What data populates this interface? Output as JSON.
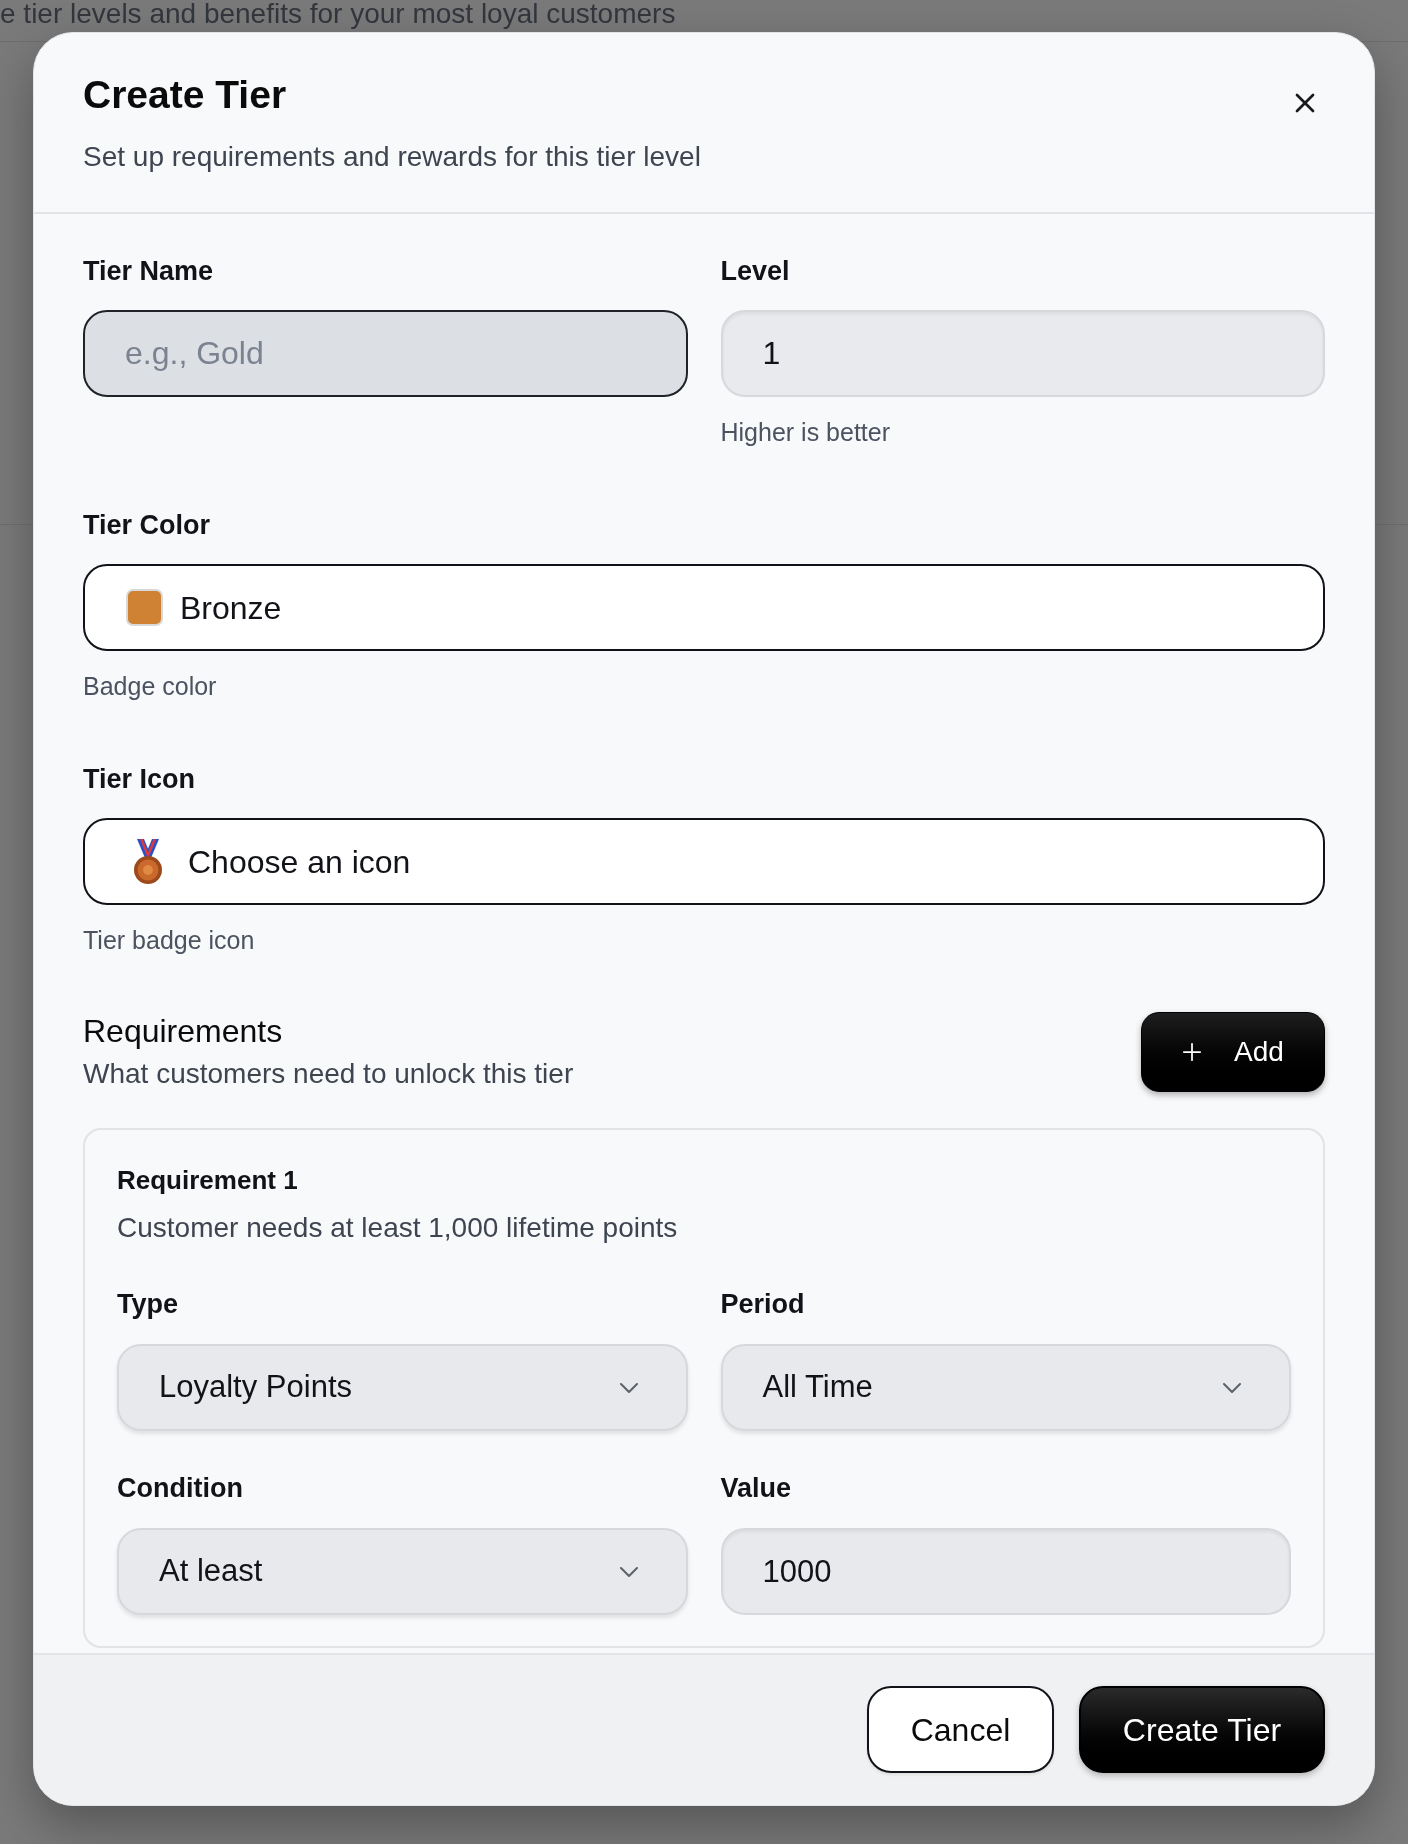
{
  "background": {
    "text": "e tier levels and benefits for your most loyal customers"
  },
  "dialog": {
    "title": "Create Tier",
    "subtitle": "Set up requirements and rewards for this tier level"
  },
  "tier_name": {
    "label": "Tier Name",
    "placeholder": "e.g., Gold",
    "focused": true
  },
  "level": {
    "label": "Level",
    "value": "1",
    "hint": "Higher is better",
    "focused": false
  },
  "tier_color": {
    "label": "Tier Color",
    "value": "Bronze",
    "color": "#cf8234",
    "hint": "Badge color"
  },
  "tier_icon": {
    "label": "Tier Icon",
    "value": "Choose an icon",
    "hint": "Tier badge icon"
  },
  "requirements": {
    "title": "Requirements",
    "subtitle": "What customers need to unlock this tier",
    "add_button": "Add",
    "items": [
      {
        "title": "Requirement 1",
        "summary": "Customer needs at least 1,000 lifetime points",
        "fields": [
          {
            "label": "Type",
            "value": "Loyalty Points",
            "kind": "select"
          },
          {
            "label": "Period",
            "value": "All Time",
            "kind": "select"
          },
          {
            "label": "Condition",
            "value": "At least",
            "kind": "select"
          },
          {
            "label": "Value",
            "value": "1000",
            "kind": "input"
          }
        ]
      }
    ]
  },
  "footer": {
    "buttons": [
      {
        "label": "Cancel",
        "kind": "secondary"
      },
      {
        "label": "Create Tier",
        "kind": "primary"
      }
    ]
  }
}
